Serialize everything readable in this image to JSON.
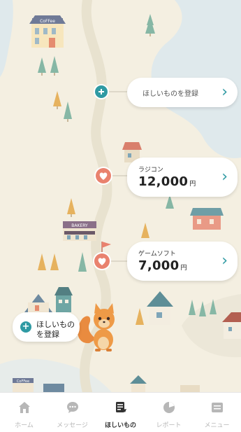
{
  "colors": {
    "map_background": "#f4efe1",
    "water": "#dfe9ec",
    "path": "#e8e2cf",
    "accent_teal": "#2f9aa3",
    "accent_coral": "#e9826e",
    "tab_active": "#333333",
    "tab_inactive": "#b7b7b7"
  },
  "map": {
    "shop_sign_top": "CoFFee",
    "shop_sign_bottom": "CoFFee",
    "bakery_sign": "BAKERY"
  },
  "wishlist": {
    "register_card": {
      "label": "ほしいものを登録",
      "icon": "plus-icon",
      "arrow": "›"
    },
    "items": [
      {
        "name": "ラジコン",
        "price": "12,000",
        "currency": "円",
        "icon": "heart-icon",
        "arrow": "›"
      },
      {
        "name": "ゲームソフト",
        "price": "7,000",
        "currency": "円",
        "icon": "heart-icon",
        "arrow": "›"
      }
    ]
  },
  "register_bubble": {
    "line1": "ほしいもの",
    "line2": "を登録",
    "icon": "plus-icon"
  },
  "tabbar": {
    "active": "ほしいもの",
    "tabs": [
      {
        "label": "ホーム",
        "icon": "home-icon"
      },
      {
        "label": "メッセージ",
        "icon": "chat-icon"
      },
      {
        "label": "ほしいもの",
        "icon": "wishlist-icon"
      },
      {
        "label": "レポート",
        "icon": "report-icon"
      },
      {
        "label": "メニュー",
        "icon": "menu-icon"
      }
    ]
  }
}
